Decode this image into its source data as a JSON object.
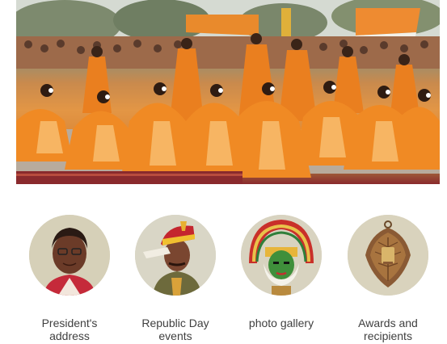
{
  "hero": {
    "image": "republic-day-dance-performance",
    "colors": {
      "costume": "#f08a24",
      "costume_light": "#f7b563",
      "carpet": "#8a2a2d",
      "sky": "#d5dad2"
    }
  },
  "tiles": [
    {
      "label": "President's address",
      "icon": "president-portrait"
    },
    {
      "label": "Republic Day events",
      "icon": "guard-salute"
    },
    {
      "label": "photo gallery",
      "icon": "kathakali-mask"
    },
    {
      "label": "Awards and recipients",
      "icon": "award-emblem"
    }
  ]
}
